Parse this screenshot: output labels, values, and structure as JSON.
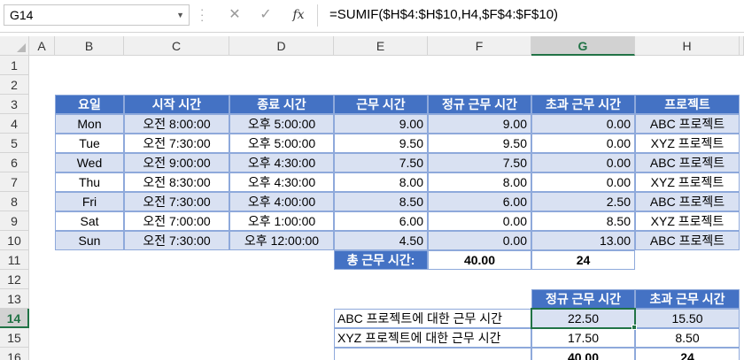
{
  "name_box": "G14",
  "formula": "=SUMIF($H$4:$H$10,H4,$F$4:$F$10)",
  "icons": {
    "cancel": "✕",
    "enter": "✓",
    "fx": "fx"
  },
  "columns": [
    "A",
    "B",
    "C",
    "D",
    "E",
    "F",
    "G",
    "H"
  ],
  "rows": [
    "1",
    "2",
    "3",
    "4",
    "5",
    "6",
    "7",
    "8",
    "9",
    "10",
    "11",
    "12",
    "13",
    "14",
    "15",
    "16"
  ],
  "selected_column": "G",
  "selected_row": "14",
  "main_table": {
    "headers": [
      "요일",
      "시작 시간",
      "종료 시간",
      "근무 시간",
      "정규 근무 시간",
      "초과 근무 시간",
      "프로젝트"
    ],
    "rows": [
      [
        "Mon",
        "오전 8:00:00",
        "오후 5:00:00",
        "9.00",
        "9.00",
        "0.00",
        "ABC 프로젝트"
      ],
      [
        "Tue",
        "오전 7:30:00",
        "오후 5:00:00",
        "9.50",
        "9.50",
        "0.00",
        "XYZ 프로젝트"
      ],
      [
        "Wed",
        "오전 9:00:00",
        "오후 4:30:00",
        "7.50",
        "7.50",
        "0.00",
        "ABC 프로젝트"
      ],
      [
        "Thu",
        "오전 8:30:00",
        "오후 4:30:00",
        "8.00",
        "8.00",
        "0.00",
        "XYZ 프로젝트"
      ],
      [
        "Fri",
        "오전 7:30:00",
        "오후 4:00:00",
        "8.50",
        "6.00",
        "2.50",
        "ABC 프로젝트"
      ],
      [
        "Sat",
        "오전 7:00:00",
        "오후 1:00:00",
        "6.00",
        "0.00",
        "8.50",
        "XYZ 프로젝트"
      ],
      [
        "Sun",
        "오전 7:30:00",
        "오후 12:00:00",
        "4.50",
        "0.00",
        "13.00",
        "ABC 프로젝트"
      ]
    ],
    "total_label": "총 근무 시간:",
    "total_regular": "40.00",
    "total_overtime": "24"
  },
  "summary_table": {
    "headers": [
      "정규 근무 시간",
      "초과 근무 시간"
    ],
    "rows": [
      {
        "label": "ABC 프로젝트에 대한 근무 시간",
        "regular": "22.50",
        "overtime": "15.50"
      },
      {
        "label": "XYZ 프로젝트에 대한 근무 시간",
        "regular": "17.50",
        "overtime": "8.50"
      }
    ],
    "total_regular": "40.00",
    "total_overtime": "24"
  }
}
